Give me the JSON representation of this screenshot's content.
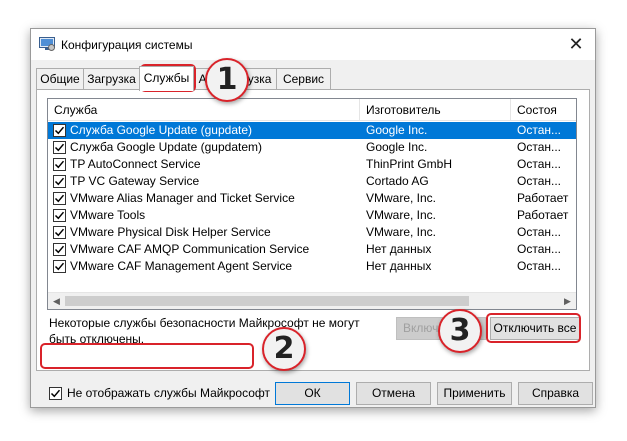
{
  "window": {
    "title": "Конфигурация системы",
    "icon": "msconfig-icon",
    "close_glyph": "✕"
  },
  "tabs": [
    {
      "label": "Общие",
      "active": false
    },
    {
      "label": "Загрузка",
      "active": false
    },
    {
      "label": "Службы",
      "active": true
    },
    {
      "label": "Автозагрузка",
      "active": false
    },
    {
      "label": "Сервис",
      "active": false
    }
  ],
  "services": {
    "columns": [
      "Служба",
      "Изготовитель",
      "Состоя"
    ],
    "rows": [
      {
        "name": "Служба Google Update (gupdate)",
        "maker": "Google Inc.",
        "status": "Остан...",
        "checked": true,
        "selected": true
      },
      {
        "name": "Служба Google Update (gupdatem)",
        "maker": "Google Inc.",
        "status": "Остан...",
        "checked": true,
        "selected": false
      },
      {
        "name": "TP AutoConnect Service",
        "maker": "ThinPrint GmbH",
        "status": "Остан...",
        "checked": true,
        "selected": false
      },
      {
        "name": "TP VC Gateway Service",
        "maker": "Cortado AG",
        "status": "Остан...",
        "checked": true,
        "selected": false
      },
      {
        "name": "VMware Alias Manager and Ticket Service",
        "maker": "VMware, Inc.",
        "status": "Работает",
        "checked": true,
        "selected": false
      },
      {
        "name": "VMware Tools",
        "maker": "VMware, Inc.",
        "status": "Работает",
        "checked": true,
        "selected": false
      },
      {
        "name": "VMware Physical Disk Helper Service",
        "maker": "VMware, Inc.",
        "status": "Остан...",
        "checked": true,
        "selected": false
      },
      {
        "name": "VMware CAF AMQP Communication Service",
        "maker": "Нет данных",
        "status": "Остан...",
        "checked": true,
        "selected": false
      },
      {
        "name": "VMware CAF Management Agent Service",
        "maker": "Нет данных",
        "status": "Остан...",
        "checked": true,
        "selected": false
      }
    ]
  },
  "scroll_arrows": {
    "left": "◀",
    "right": "▶"
  },
  "note": "Некоторые службы безопасности Майкрософт не могут быть отключены.",
  "buttons": {
    "enable_all": "Включить все",
    "disable_all": "Отключить все",
    "ok": "ОК",
    "cancel": "Отмена",
    "apply": "Применить",
    "help": "Справка"
  },
  "hide_ms": {
    "label": "Не отображать службы Майкрософт",
    "checked": true
  },
  "callouts": [
    "1",
    "2",
    "3"
  ],
  "colors": {
    "highlight": "#d9232a",
    "selection": "#0078d7"
  }
}
